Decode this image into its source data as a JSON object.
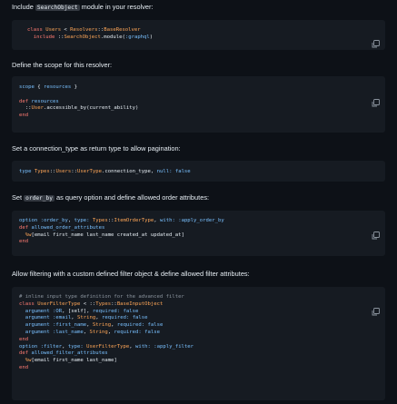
{
  "sections": [
    {
      "intro_before": "Include ",
      "intro_code": "SearchObject",
      "intro_after": " module in your resolver:",
      "code": [
        [
          [
            "k",
            "class "
          ],
          [
            "t",
            "Users"
          ],
          [
            "p",
            " < "
          ],
          [
            "t",
            "Resolvers"
          ],
          [
            "p",
            "::"
          ],
          [
            "t",
            "BaseResolver"
          ]
        ],
        [
          [
            "p",
            "  "
          ],
          [
            "k",
            "include "
          ],
          [
            "p",
            "::"
          ],
          [
            "t",
            "SearchObject"
          ],
          [
            "p",
            "."
          ],
          [
            "p",
            "module"
          ],
          [
            "p",
            "("
          ],
          [
            "c",
            ":graphql"
          ],
          [
            "p",
            ")"
          ]
        ]
      ]
    },
    {
      "intro_before": "Define the scope for this resolver:",
      "intro_code": "",
      "intro_after": "",
      "code": [
        [
          [
            "c",
            "scope"
          ],
          [
            "p",
            " { "
          ],
          [
            "c",
            "resources"
          ],
          [
            "p",
            " }"
          ]
        ],
        [
          [
            "p",
            ""
          ]
        ],
        [
          [
            "k",
            "def "
          ],
          [
            "c",
            "resources"
          ]
        ],
        [
          [
            "p",
            "  ::"
          ],
          [
            "t",
            "User"
          ],
          [
            "p",
            ".accessible_by(current_ability)"
          ]
        ],
        [
          [
            "k",
            "end"
          ]
        ]
      ]
    },
    {
      "intro_before": "Set a connection_type as return type to allow pagination:",
      "intro_code": "",
      "intro_after": "",
      "code": [
        [
          [
            "c",
            "type "
          ],
          [
            "t",
            "Types"
          ],
          [
            "p",
            "::"
          ],
          [
            "t",
            "Users"
          ],
          [
            "p",
            "::"
          ],
          [
            "t",
            "UserType"
          ],
          [
            "p",
            ".connection_type, "
          ],
          [
            "c",
            "null: "
          ],
          [
            "c",
            "false"
          ]
        ]
      ]
    },
    {
      "intro_before": "Set ",
      "intro_code": "order_by",
      "intro_after": " as query option and define allowed order attributes:",
      "code": [
        [
          [
            "c",
            "option "
          ],
          [
            "c",
            ":order_by"
          ],
          [
            "p",
            ", "
          ],
          [
            "c",
            "type: "
          ],
          [
            "t",
            "Types"
          ],
          [
            "p",
            "::"
          ],
          [
            "t",
            "ItemOrderType"
          ],
          [
            "p",
            ", "
          ],
          [
            "c",
            "with: "
          ],
          [
            "c",
            ":apply_order_by"
          ]
        ],
        [
          [
            "k",
            "def "
          ],
          [
            "c",
            "allowed_order_attributes"
          ]
        ],
        [
          [
            "p",
            "  "
          ],
          [
            "t",
            "%w"
          ],
          [
            "p",
            "[email first_name last_name created_at updated_at]"
          ]
        ],
        [
          [
            "k",
            "end"
          ]
        ]
      ]
    },
    {
      "intro_before": "Allow filtering with a custom defined filter object & define allowed filter attributes:",
      "intro_code": "",
      "intro_after": "",
      "code": [
        [
          [
            "cm",
            "# inline input type definition for the advanced filter"
          ]
        ],
        [
          [
            "k",
            "class "
          ],
          [
            "t",
            "UserFilterType"
          ],
          [
            "p",
            " < ::"
          ],
          [
            "t",
            "Types"
          ],
          [
            "p",
            "::"
          ],
          [
            "t",
            "BaseInputObject"
          ]
        ],
        [
          [
            "p",
            "  "
          ],
          [
            "c",
            "argument "
          ],
          [
            "c",
            ":OR"
          ],
          [
            "p",
            ", [self], "
          ],
          [
            "c",
            "required: "
          ],
          [
            "c",
            "false"
          ]
        ],
        [
          [
            "p",
            "  "
          ],
          [
            "c",
            "argument "
          ],
          [
            "c",
            ":email"
          ],
          [
            "p",
            ", "
          ],
          [
            "t",
            "String"
          ],
          [
            "p",
            ", "
          ],
          [
            "c",
            "required: "
          ],
          [
            "c",
            "false"
          ]
        ],
        [
          [
            "p",
            "  "
          ],
          [
            "c",
            "argument "
          ],
          [
            "c",
            ":first_name"
          ],
          [
            "p",
            ", "
          ],
          [
            "t",
            "String"
          ],
          [
            "p",
            ", "
          ],
          [
            "c",
            "required: "
          ],
          [
            "c",
            "false"
          ]
        ],
        [
          [
            "p",
            "  "
          ],
          [
            "c",
            "argument "
          ],
          [
            "c",
            ":last_name"
          ],
          [
            "p",
            ", "
          ],
          [
            "t",
            "String"
          ],
          [
            "p",
            ", "
          ],
          [
            "c",
            "required: "
          ],
          [
            "c",
            "false"
          ]
        ],
        [
          [
            "k",
            "end"
          ]
        ],
        [
          [
            "c",
            "option "
          ],
          [
            "c",
            ":filter"
          ],
          [
            "p",
            ", "
          ],
          [
            "c",
            "type: "
          ],
          [
            "t",
            "UserFilterType"
          ],
          [
            "p",
            ", "
          ],
          [
            "c",
            "with: "
          ],
          [
            "c",
            ":apply_filter"
          ]
        ],
        [
          [
            "k",
            "def "
          ],
          [
            "c",
            "allowed_filter_attributes"
          ]
        ],
        [
          [
            "p",
            "  "
          ],
          [
            "t",
            "%w"
          ],
          [
            "p",
            "[email first_name last_name]"
          ]
        ],
        [
          [
            "k",
            "end"
          ]
        ]
      ]
    }
  ]
}
